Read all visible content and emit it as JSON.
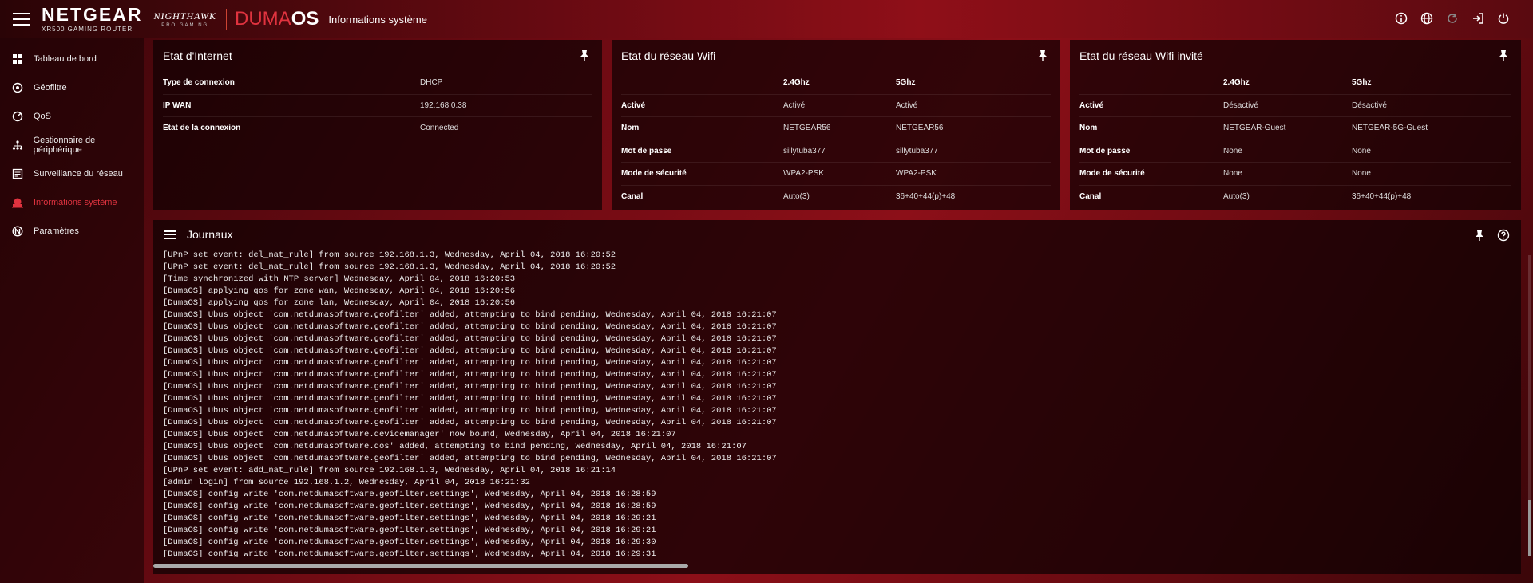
{
  "header": {
    "brand": "NETGEAR",
    "model": "XR500 GAMING ROUTER",
    "nighthawk": "NIGHTHAWK",
    "pro_gaming": "PRO GAMING",
    "duma_part1": "DUMA",
    "duma_part2": "OS",
    "page_title": "Informations système",
    "icons": [
      "info-icon",
      "globe-icon",
      "refresh-icon",
      "logout-icon",
      "power-icon"
    ]
  },
  "sidebar": {
    "items": [
      {
        "label": "Tableau de bord",
        "icon": "dashboard-icon"
      },
      {
        "label": "Géofiltre",
        "icon": "geofilter-icon"
      },
      {
        "label": "QoS",
        "icon": "qos-icon"
      },
      {
        "label": "Gestionnaire de périphérique",
        "icon": "device-manager-icon"
      },
      {
        "label": "Surveillance du réseau",
        "icon": "network-monitor-icon"
      },
      {
        "label": "Informations système",
        "icon": "system-info-icon",
        "active": true
      },
      {
        "label": "Paramètres",
        "icon": "settings-icon"
      }
    ],
    "active_color": "#e0333f"
  },
  "internet": {
    "title": "Etat d'Internet",
    "rows": [
      {
        "label": "Type de connexion",
        "value": "DHCP"
      },
      {
        "label": "IP WAN",
        "value": "192.168.0.38"
      },
      {
        "label": "Etat de la connexion",
        "value": "Connected"
      }
    ]
  },
  "wifi": {
    "title": "Etat du réseau Wifi",
    "col1": "2.4Ghz",
    "col2": "5Ghz",
    "rows": [
      {
        "label": "Activé",
        "v1": "Activé",
        "v2": "Activé"
      },
      {
        "label": "Nom",
        "v1": "NETGEAR56",
        "v2": "NETGEAR56"
      },
      {
        "label": "Mot de passe",
        "v1": "sillytuba377",
        "v2": "sillytuba377"
      },
      {
        "label": "Mode de sécurité",
        "v1": "WPA2-PSK",
        "v2": "WPA2-PSK"
      },
      {
        "label": "Canal",
        "v1": "Auto(3)",
        "v2": "36+40+44(p)+48"
      }
    ]
  },
  "guest": {
    "title": "Etat du réseau Wifi invité",
    "col1": "2.4Ghz",
    "col2": "5Ghz",
    "rows": [
      {
        "label": "Activé",
        "v1": "Désactivé",
        "v2": "Désactivé"
      },
      {
        "label": "Nom",
        "v1": "NETGEAR-Guest",
        "v2": "NETGEAR-5G-Guest"
      },
      {
        "label": "Mot de passe",
        "v1": "None",
        "v2": "None"
      },
      {
        "label": "Mode de sécurité",
        "v1": "None",
        "v2": "None"
      },
      {
        "label": "Canal",
        "v1": "Auto(3)",
        "v2": "36+40+44(p)+48"
      }
    ]
  },
  "logs": {
    "title": "Journaux",
    "lines": [
      "[UPnP set event: del_nat_rule] from source 192.168.1.3, Wednesday, April 04, 2018 16:20:52",
      "[UPnP set event: del_nat_rule] from source 192.168.1.3, Wednesday, April 04, 2018 16:20:52",
      "[Time synchronized with NTP server] Wednesday, April 04, 2018 16:20:53",
      "[DumaOS] applying qos for zone wan, Wednesday, April 04, 2018 16:20:56",
      "[DumaOS] applying qos for zone lan, Wednesday, April 04, 2018 16:20:56",
      "[DumaOS] Ubus object 'com.netdumasoftware.geofilter' added, attempting to bind pending, Wednesday, April 04, 2018 16:21:07",
      "[DumaOS] Ubus object 'com.netdumasoftware.geofilter' added, attempting to bind pending, Wednesday, April 04, 2018 16:21:07",
      "[DumaOS] Ubus object 'com.netdumasoftware.geofilter' added, attempting to bind pending, Wednesday, April 04, 2018 16:21:07",
      "[DumaOS] Ubus object 'com.netdumasoftware.geofilter' added, attempting to bind pending, Wednesday, April 04, 2018 16:21:07",
      "[DumaOS] Ubus object 'com.netdumasoftware.geofilter' added, attempting to bind pending, Wednesday, April 04, 2018 16:21:07",
      "[DumaOS] Ubus object 'com.netdumasoftware.geofilter' added, attempting to bind pending, Wednesday, April 04, 2018 16:21:07",
      "[DumaOS] Ubus object 'com.netdumasoftware.geofilter' added, attempting to bind pending, Wednesday, April 04, 2018 16:21:07",
      "[DumaOS] Ubus object 'com.netdumasoftware.geofilter' added, attempting to bind pending, Wednesday, April 04, 2018 16:21:07",
      "[DumaOS] Ubus object 'com.netdumasoftware.geofilter' added, attempting to bind pending, Wednesday, April 04, 2018 16:21:07",
      "[DumaOS] Ubus object 'com.netdumasoftware.geofilter' added, attempting to bind pending, Wednesday, April 04, 2018 16:21:07",
      "[DumaOS] Ubus object 'com.netdumasoftware.devicemanager' now bound, Wednesday, April 04, 2018 16:21:07",
      "[DumaOS] Ubus object 'com.netdumasoftware.qos' added, attempting to bind pending, Wednesday, April 04, 2018 16:21:07",
      "[DumaOS] Ubus object 'com.netdumasoftware.geofilter' added, attempting to bind pending, Wednesday, April 04, 2018 16:21:07",
      "[UPnP set event: add_nat_rule] from source 192.168.1.3, Wednesday, April 04, 2018 16:21:14",
      "[admin login] from source 192.168.1.2, Wednesday, April 04, 2018 16:21:32",
      "[DumaOS] config write 'com.netdumasoftware.geofilter.settings', Wednesday, April 04, 2018 16:28:59",
      "[DumaOS] config write 'com.netdumasoftware.geofilter.settings', Wednesday, April 04, 2018 16:28:59",
      "[DumaOS] config write 'com.netdumasoftware.geofilter.settings', Wednesday, April 04, 2018 16:29:21",
      "[DumaOS] config write 'com.netdumasoftware.geofilter.settings', Wednesday, April 04, 2018 16:29:21",
      "[DumaOS] config write 'com.netdumasoftware.geofilter.settings', Wednesday, April 04, 2018 16:29:30",
      "[DumaOS] config write 'com.netdumasoftware.geofilter.settings', Wednesday, April 04, 2018 16:29:31"
    ]
  }
}
